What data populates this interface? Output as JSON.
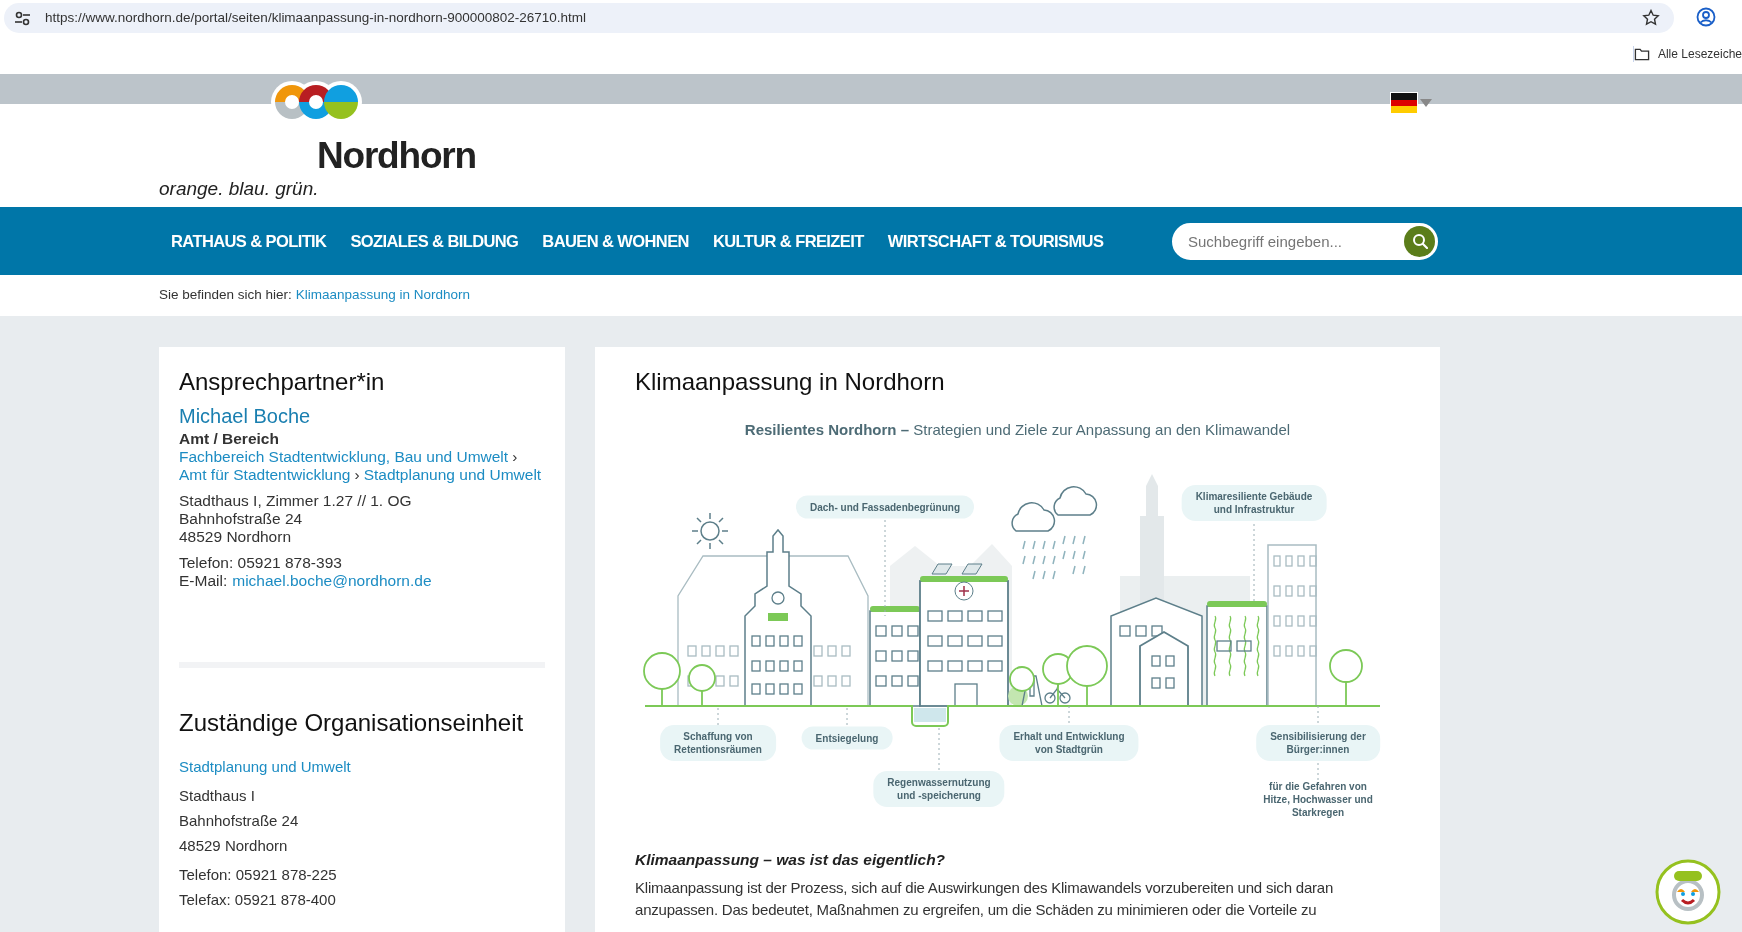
{
  "browser": {
    "url": "https://www.nordhorn.de/portal/seiten/klimaanpassung-in-nordhorn-900000802-26710.html",
    "bookmarks": "Alle Lesezeiche"
  },
  "header": {
    "site_name": "Nordhorn",
    "tagline": "orange. blau. grün."
  },
  "nav": {
    "items": [
      "RATHAUS & POLITIK",
      "SOZIALES & BILDUNG",
      "BAUEN & WOHNEN",
      "KULTUR & FREIZEIT",
      "WIRTSCHAFT & TOURISMUS"
    ],
    "search": {
      "placeholder": "Suchbegriff eingeben..."
    }
  },
  "breadcrumb": {
    "label": "Sie befinden sich hier:",
    "current": "Klimaanpassung in Nordhorn"
  },
  "contact": {
    "heading": "Ansprechpartner*in",
    "name": "Michael Boche",
    "dept_label": "Amt / Bereich",
    "dept_path": [
      "Fachbereich Stadtentwicklung, Bau und Umwelt",
      "Amt für Stadtentwicklung",
      "Stadtplanung und Umwelt"
    ],
    "separator": "›",
    "address": [
      "Stadthaus I, Zimmer 1.27 // 1. OG",
      "Bahnhofstraße 24",
      "48529 Nordhorn"
    ],
    "phone": "Telefon: 05921 878-393",
    "email_label": "E-Mail:",
    "email": "michael.boche@nordhorn.de"
  },
  "org": {
    "heading": "Zuständige Organisationseinheit",
    "name": "Stadtplanung und Umwelt",
    "address": [
      "Stadthaus I",
      "Bahnhofstraße 24",
      "48529 Nordhorn"
    ],
    "contact": [
      "Telefon: 05921 878-225",
      "Telefax: 05921 878-400"
    ]
  },
  "article": {
    "title": "Klimaanpassung in Nordhorn",
    "infographic": {
      "title_bold": "Resilientes Nordhorn –",
      "title": "Strategien und Ziele zur Anpassung an den Klimawandel",
      "labels": [
        {
          "kind": "pill",
          "lines": [
            "Dach- und Fassadenbegrünung"
          ]
        },
        {
          "kind": "pill",
          "lines": [
            "Klimaresiliente Gebäude",
            "und Infrastruktur"
          ]
        },
        {
          "kind": "pill",
          "lines": [
            "Schaffung von",
            "Retentionsräumen"
          ]
        },
        {
          "kind": "pill",
          "lines": [
            "Entsiegelung"
          ]
        },
        {
          "kind": "pill",
          "lines": [
            "Regenwassernutzung",
            "und -speicherung"
          ]
        },
        {
          "kind": "pill",
          "lines": [
            "Erhalt und Entwicklung",
            "von Stadtgrün"
          ]
        },
        {
          "kind": "pill",
          "lines": [
            "Sensibilisierung der",
            "Bürger:innen"
          ]
        },
        {
          "kind": "note",
          "lines": [
            "für die Gefahren von",
            "Hitze, Hochwasser und",
            "Starkregen"
          ]
        }
      ]
    },
    "subheading": "Klimaanpassung – was ist das eigentlich?",
    "paragraph": "Klimaanpassung ist der Prozess, sich auf die Auswirkungen des Klimawandels vorzubereiten und sich daran anzupassen. Das bedeutet, Maßnahmen zu ergreifen, um die Schäden zu minimieren oder die Vorteile zu"
  }
}
